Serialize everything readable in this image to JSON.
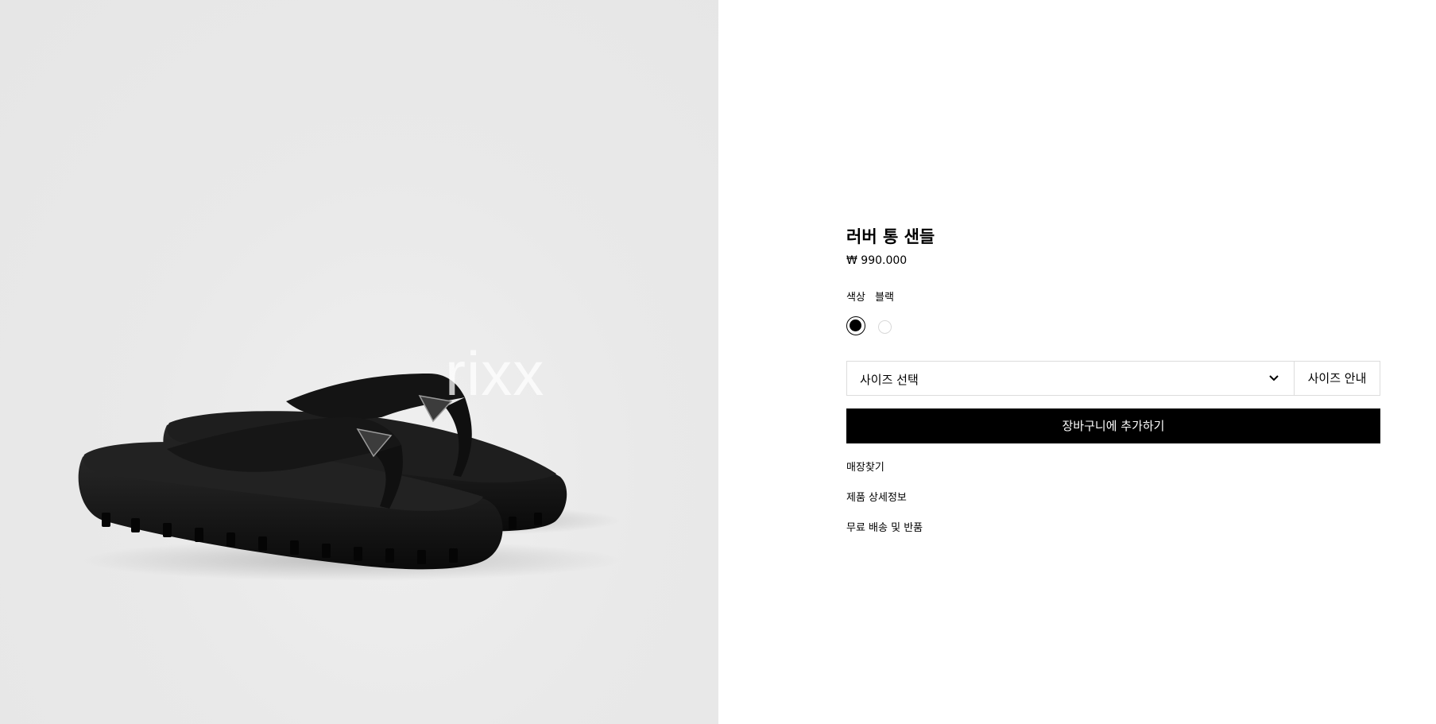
{
  "product_media": {
    "watermark": "rixx"
  },
  "product": {
    "title": "러버 통 샌들",
    "price": "₩ 990.000",
    "color_label": "색상",
    "color_value": "블랙",
    "swatches": [
      {
        "name": "black",
        "color": "#000000",
        "selected": true
      },
      {
        "name": "white",
        "color": "#ffffff",
        "selected": false
      }
    ]
  },
  "size": {
    "select_value": "사이즈 선택",
    "guide_label": "사이즈 안내"
  },
  "cart": {
    "add_label": "장바구니에 추가하기"
  },
  "links": [
    {
      "label": "매장찾기"
    },
    {
      "label": "제품 상세정보"
    },
    {
      "label": "무료 배송 및 반품"
    }
  ]
}
